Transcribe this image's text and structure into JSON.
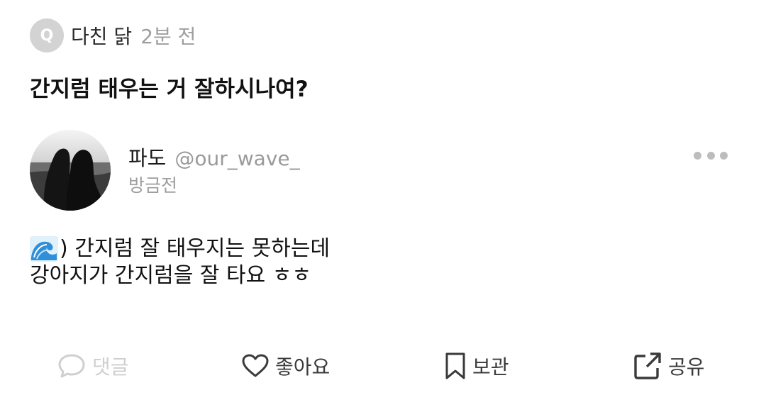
{
  "question": {
    "badge": "Q",
    "asker": "다친 닭",
    "time": "2분 전",
    "text": "간지럼 태우는 거 잘하시나여?"
  },
  "answer": {
    "author_name": "파도",
    "author_handle": "@our_wave_",
    "time": "방금전",
    "lines": [
      ") 간지럼 잘 태우지는 못하는데",
      "강아지가 간지럼을 잘 타요 ㅎㅎ"
    ],
    "leading_icon": "water-wave-emoji"
  },
  "actions": {
    "comment": "댓글",
    "like": "좋아요",
    "save": "보관",
    "share": "공유"
  },
  "colors": {
    "muted": "#9e9e9e",
    "disabled": "#cfcfcf",
    "badge": "#d3d3d3",
    "text": "#111111"
  }
}
